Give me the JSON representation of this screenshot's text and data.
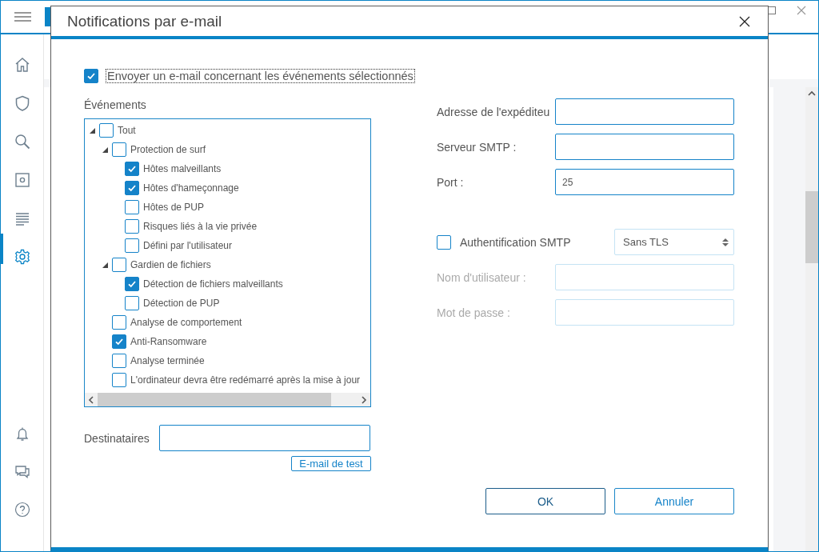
{
  "app": {
    "sidebar": [
      {
        "selected": false
      },
      {
        "selected": false
      },
      {
        "selected": false
      },
      {
        "selected": false
      },
      {
        "selected": false
      },
      {
        "selected": true
      }
    ]
  },
  "dialog": {
    "title": "Notifications par e-mail",
    "send_email": {
      "label": "Envoyer un e-mail concernant les événements sélectionnés",
      "checked": true,
      "focused": true
    },
    "events": {
      "label": "Événements",
      "tree": [
        {
          "label": "Tout",
          "checked": false,
          "expanded": true,
          "children": [
            {
              "label": "Protection de surf",
              "checked": false,
              "expanded": true,
              "children": [
                {
                  "label": "Hôtes malveillants",
                  "checked": true
                },
                {
                  "label": "Hôtes d'hameçonnage",
                  "checked": true
                },
                {
                  "label": "Hôtes de PUP",
                  "checked": false
                },
                {
                  "label": "Risques liés à la vie privée",
                  "checked": false
                },
                {
                  "label": "Défini par l'utilisateur",
                  "checked": false
                }
              ]
            },
            {
              "label": "Gardien de fichiers",
              "checked": false,
              "expanded": true,
              "children": [
                {
                  "label": "Détection de fichiers malveillants",
                  "checked": true
                },
                {
                  "label": "Détection de PUP",
                  "checked": false
                }
              ]
            },
            {
              "label": "Analyse de comportement",
              "checked": false
            },
            {
              "label": "Anti-Ransomware",
              "checked": true
            },
            {
              "label": "Analyse terminée",
              "checked": false
            },
            {
              "label": "L'ordinateur devra être redémarré après la mise à jour",
              "checked": false
            }
          ]
        }
      ]
    },
    "fields": [
      {
        "label": "Adresse de l'expéditeu",
        "disabled": false
      },
      {
        "label": "Serveur SMTP :",
        "disabled": false
      },
      {
        "label": "Port :",
        "value": "25",
        "disabled": false
      }
    ],
    "smtp_auth": {
      "label": "Authentification SMTP",
      "checked": false
    },
    "encryption": {
      "value": "Sans TLS"
    },
    "auth_fields": [
      {
        "label": "Nom d'utilisateur :",
        "disabled": true
      },
      {
        "label": "Mot de passe :",
        "disabled": true
      }
    ],
    "recipients": {
      "label": "Destinataires"
    },
    "test_button": "E-mail de test",
    "buttons": [
      {
        "label": "OK",
        "default": true
      },
      {
        "label": "Annuler",
        "default": false
      }
    ]
  }
}
